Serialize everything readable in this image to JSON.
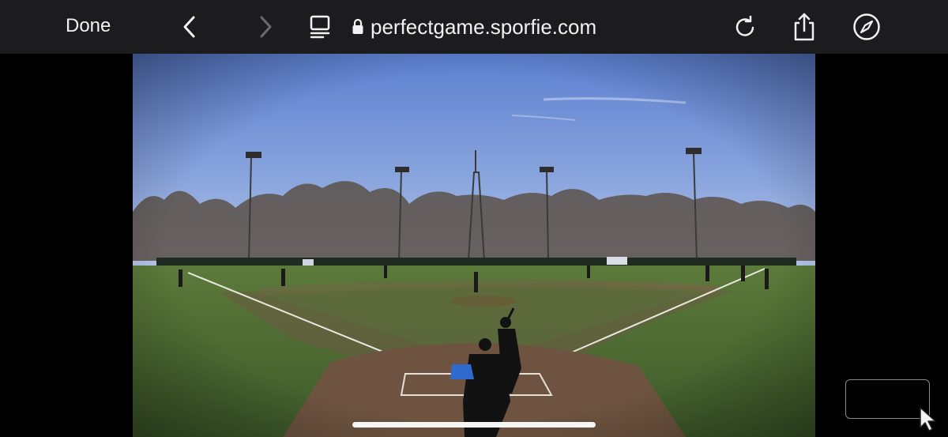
{
  "toolbar": {
    "done_label": "Done",
    "url": "perfectgame.sporfie.com",
    "icons": {
      "back": "chevron-left-icon",
      "forward": "chevron-right-icon",
      "reader": "reader-mode-icon",
      "lock": "lock-icon",
      "reload": "reload-icon",
      "share": "share-icon",
      "safari": "compass-icon"
    }
  },
  "video": {
    "description_icon": "baseball-field-video"
  },
  "colors": {
    "toolbar_bg": "#1c1c1e",
    "text": "#f2f2f2",
    "forward_disabled": "#6b6b6b"
  }
}
